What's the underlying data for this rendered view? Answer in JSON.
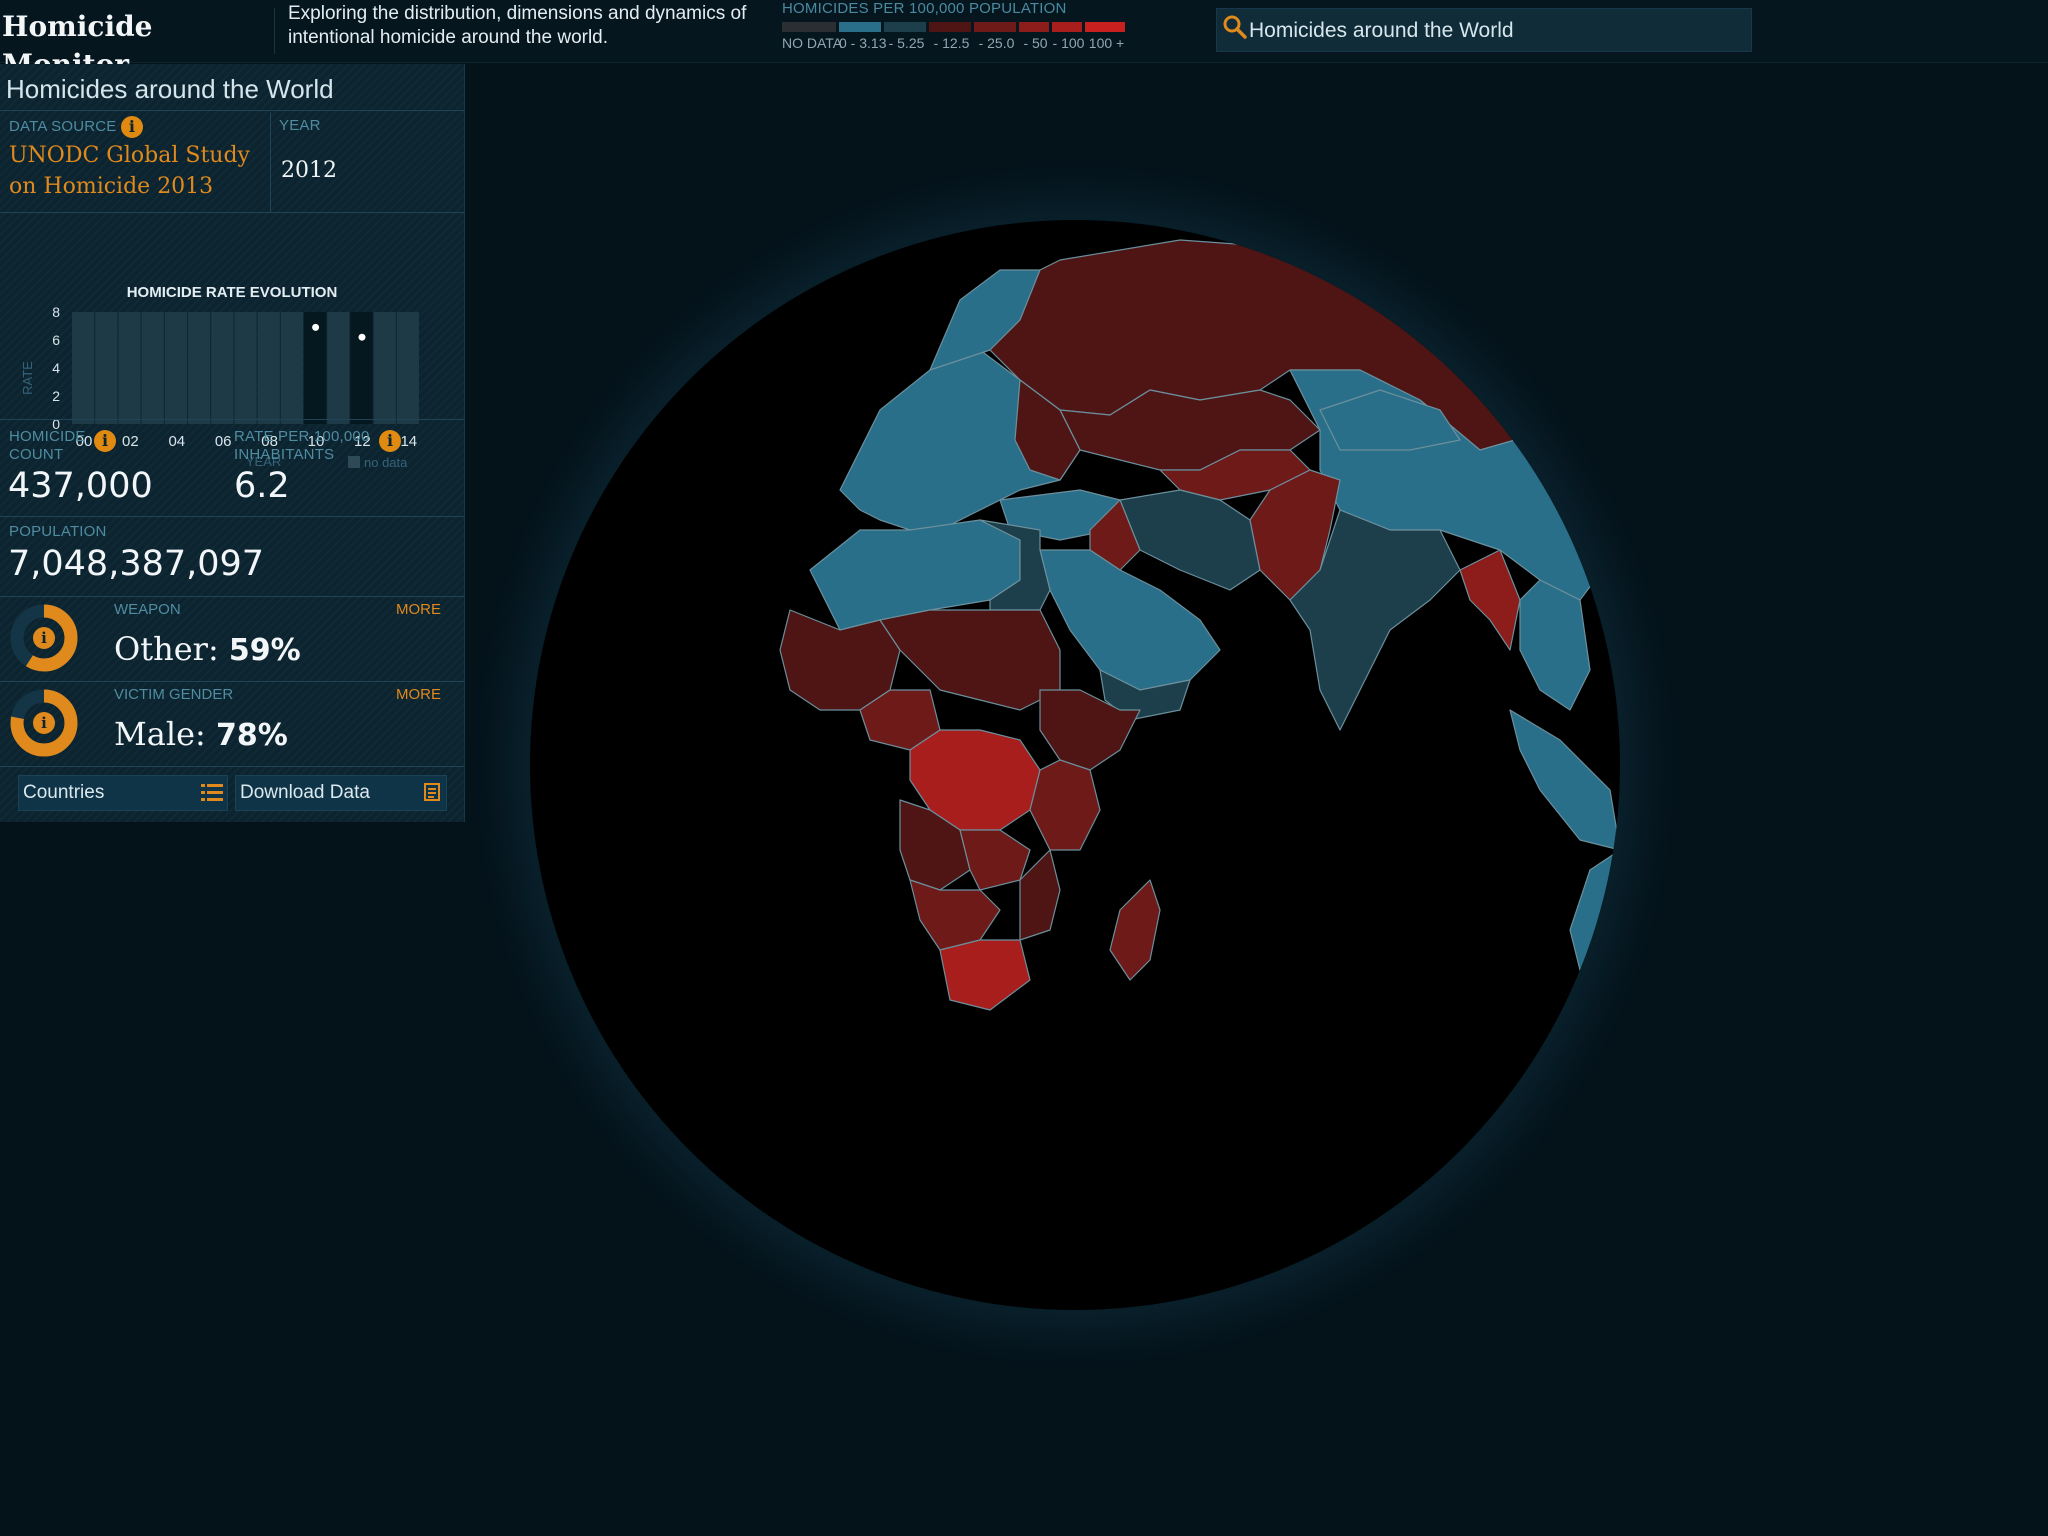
{
  "header": {
    "app_title": "Homicide Monitor",
    "tagline": "Exploring the distribution, dimensions and dynamics of intentional homicide around the world."
  },
  "legend": {
    "title": "HOMICIDES PER 100,000 POPULATION",
    "items": [
      {
        "label": "NO DATA",
        "color": "#2b2f33"
      },
      {
        "label": "0 - 3.13",
        "color": "#2a6f8a"
      },
      {
        "label": "- 5.25",
        "color": "#1d3f4c"
      },
      {
        "label": "- 12.5",
        "color": "#4e1514"
      },
      {
        "label": "- 25.0",
        "color": "#6e1a18"
      },
      {
        "label": "- 50",
        "color": "#8c1d1b"
      },
      {
        "label": "- 100",
        "color": "#a81e1c"
      },
      {
        "label": "100 +",
        "color": "#c8201e"
      }
    ]
  },
  "search": {
    "value": "Homicides around the World",
    "icon": "search-icon"
  },
  "panel": {
    "title": "Homicides around the World",
    "data_source_label": "DATA SOURCE",
    "data_source_value": "UNODC Global Study on Homicide 2013",
    "year_label": "YEAR",
    "year_value": "2012",
    "homicide_count_label": "HOMICIDE COUNT",
    "homicide_count_value": "437,000",
    "rate_label": "RATE PER 100,000 INHABITANTS",
    "rate_value": "6.2",
    "population_label": "POPULATION",
    "population_value": "7,048,387,097",
    "weapon_label": "WEAPON",
    "weapon_more": "MORE",
    "weapon_category": "Other:",
    "weapon_percent": "59%",
    "weapon_fraction": 0.59,
    "gender_label": "VICTIM GENDER",
    "gender_more": "MORE",
    "gender_category": "Male:",
    "gender_percent": "78%",
    "gender_fraction": 0.78,
    "countries_button": "Countries",
    "download_button": "Download Data"
  },
  "chart_data": {
    "type": "scatter",
    "title": "HOMICIDE RATE EVOLUTION",
    "xlabel": "YEAR",
    "ylabel": "RATE",
    "x_ticks": [
      "00",
      "02",
      "04",
      "06",
      "08",
      "10",
      "12",
      "14"
    ],
    "y_ticks": [
      "0",
      "2",
      "4",
      "6",
      "8"
    ],
    "ylim": [
      0,
      8
    ],
    "xlim": [
      2000,
      2015
    ],
    "points": [
      {
        "x": 2010,
        "y": 6.9
      },
      {
        "x": 2012,
        "y": 6.2
      }
    ],
    "data_years": [
      2010,
      2012
    ],
    "legend": "no data"
  },
  "colors": {
    "accent": "#e0891d",
    "panel_bg": "#0b2430",
    "ocean": "#000000"
  }
}
